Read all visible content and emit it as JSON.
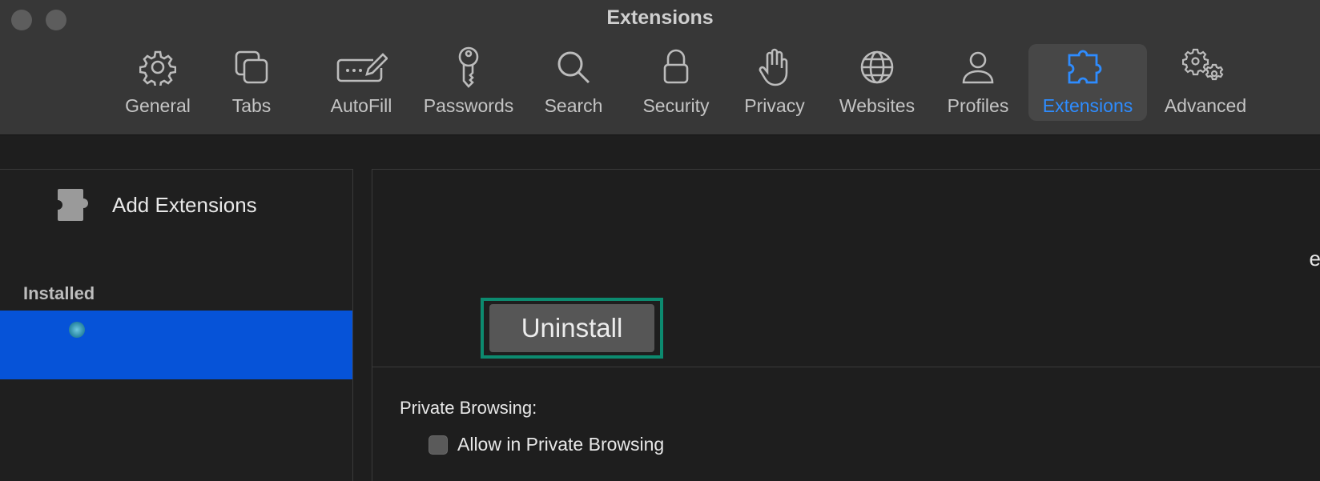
{
  "window": {
    "title": "Extensions"
  },
  "toolbar": {
    "tabs": [
      {
        "id": "general",
        "label": "General",
        "icon": "gear-icon"
      },
      {
        "id": "tabs",
        "label": "Tabs",
        "icon": "tabs-icon"
      },
      {
        "id": "autofill",
        "label": "AutoFill",
        "icon": "autofill-icon"
      },
      {
        "id": "passwords",
        "label": "Passwords",
        "icon": "key-icon"
      },
      {
        "id": "search",
        "label": "Search",
        "icon": "magnifier-icon"
      },
      {
        "id": "security",
        "label": "Security",
        "icon": "lock-icon"
      },
      {
        "id": "privacy",
        "label": "Privacy",
        "icon": "hand-icon"
      },
      {
        "id": "websites",
        "label": "Websites",
        "icon": "globe-icon"
      },
      {
        "id": "profiles",
        "label": "Profiles",
        "icon": "person-icon"
      },
      {
        "id": "extensions",
        "label": "Extensions",
        "icon": "puzzle-icon",
        "active": true
      },
      {
        "id": "advanced",
        "label": "Advanced",
        "icon": "gears-icon"
      }
    ],
    "accent_color": "#2e8cff"
  },
  "sidebar": {
    "add_extensions_label": "Add Extensions",
    "installed_title": "Installed",
    "selected_color": "#0653d8"
  },
  "detail": {
    "uninstall_label": "Uninstall",
    "edge_text": "e",
    "private_browsing_label": "Private Browsing:",
    "allow_private_label": "Allow in Private Browsing",
    "allow_private_checked": false,
    "highlight_color": "#0c8a6f"
  }
}
